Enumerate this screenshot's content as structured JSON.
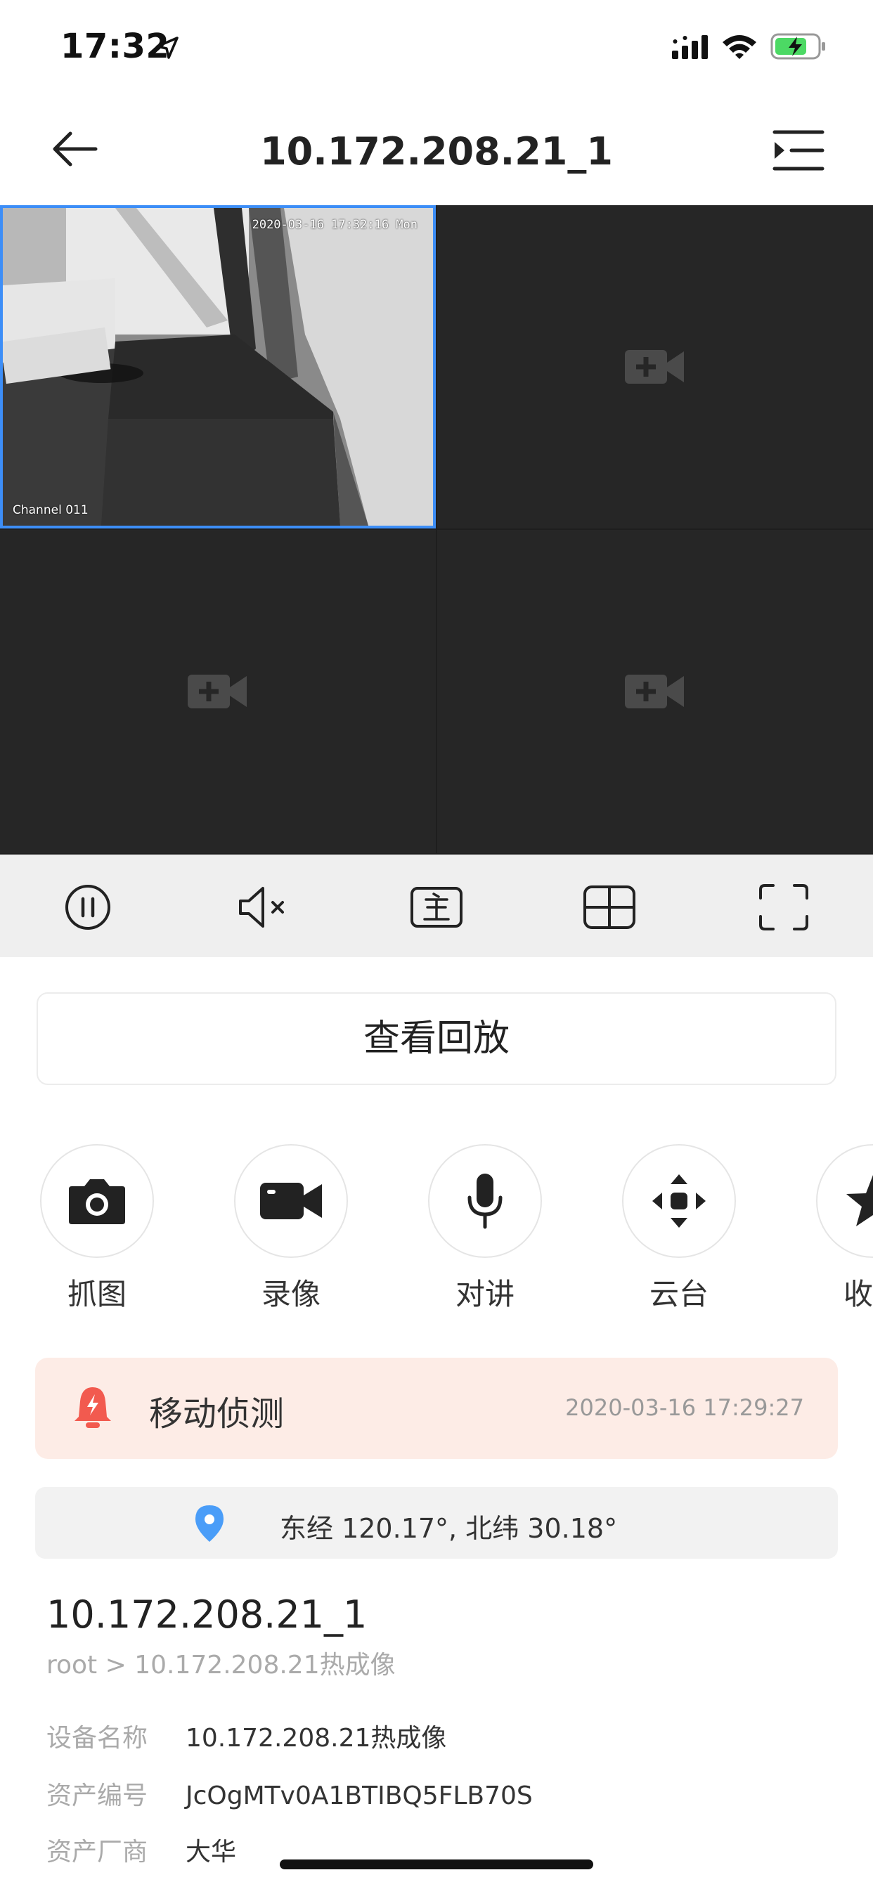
{
  "status_bar": {
    "time": "17:32"
  },
  "nav": {
    "title": "10.172.208.21_1"
  },
  "video": {
    "active_cell": {
      "timestamp": "2020-03-16 17:32:16 Mon",
      "channel": "Channel 011"
    },
    "empty_cells": 3
  },
  "controls": [
    "pause",
    "mute",
    "main-stream",
    "split-screen",
    "fullscreen"
  ],
  "playback": {
    "label": "查看回放"
  },
  "functions": [
    {
      "label": "抓图",
      "icon": "camera-icon"
    },
    {
      "label": "录像",
      "icon": "video-camera-icon"
    },
    {
      "label": "对讲",
      "icon": "microphone-icon"
    },
    {
      "label": "云台",
      "icon": "ptz-arrows-icon"
    },
    {
      "label": "收藏",
      "icon": "star-icon"
    }
  ],
  "alarm": {
    "title": "移动侦测",
    "time": "2020-03-16 17:29:27"
  },
  "location": {
    "text": "东经 120.17°, 北纬 30.18°"
  },
  "device": {
    "title": "10.172.208.21_1",
    "path": "root > 10.172.208.21热成像",
    "rows": [
      {
        "key": "设备名称",
        "value": "10.172.208.21热成像"
      },
      {
        "key": "资产编号",
        "value": "JcOgMTv0A1BTIBQ5FLB70S"
      },
      {
        "key": "资产厂商",
        "value": "大华"
      }
    ]
  },
  "colors": {
    "accent": "#3d8ef7",
    "alarm_bg": "#fdece6",
    "alarm_icon": "#f25a4f",
    "pin": "#4a9df8"
  }
}
